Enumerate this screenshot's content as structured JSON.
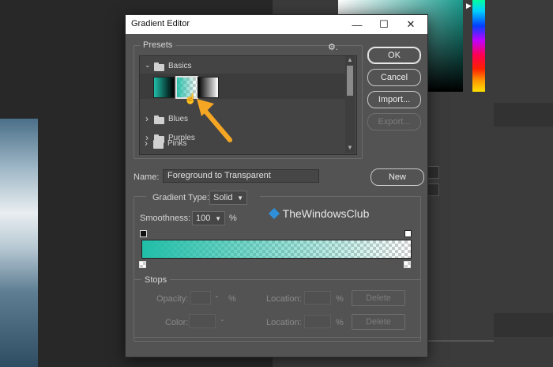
{
  "dialog": {
    "title": "Gradient Editor",
    "presets_label": "Presets",
    "gear_glyph": "⚙.",
    "folders": [
      {
        "name": "Basics",
        "expanded": true
      },
      {
        "name": "Blues",
        "expanded": false
      },
      {
        "name": "Purples",
        "expanded": false
      },
      {
        "name": "Pinks",
        "expanded": false
      }
    ],
    "buttons": {
      "ok": "OK",
      "cancel": "Cancel",
      "import": "Import...",
      "export": "Export...",
      "new": "New"
    },
    "name_label": "Name:",
    "name_value": "Foreground to Transparent",
    "gradient_type_label": "Gradient Type:",
    "gradient_type_value": "Solid",
    "smoothness_label": "Smoothness:",
    "smoothness_value": "100",
    "percent": "%",
    "stops": {
      "legend": "Stops",
      "opacity_label": "Opacity:",
      "color_label": "Color:",
      "location_label": "Location:",
      "delete_label": "Delete"
    }
  },
  "watermark": {
    "text": "TheWindowsClub"
  },
  "colors": {
    "accent_teal": "#20bea8",
    "arrow": "#f5a623",
    "dialog_bg": "#535353"
  },
  "icons": {
    "minimize": "—",
    "maximize": "☐",
    "close": "✕",
    "chevron_right": "›",
    "chevron_down": "⌄",
    "cursor": "hand-pointer-icon"
  }
}
